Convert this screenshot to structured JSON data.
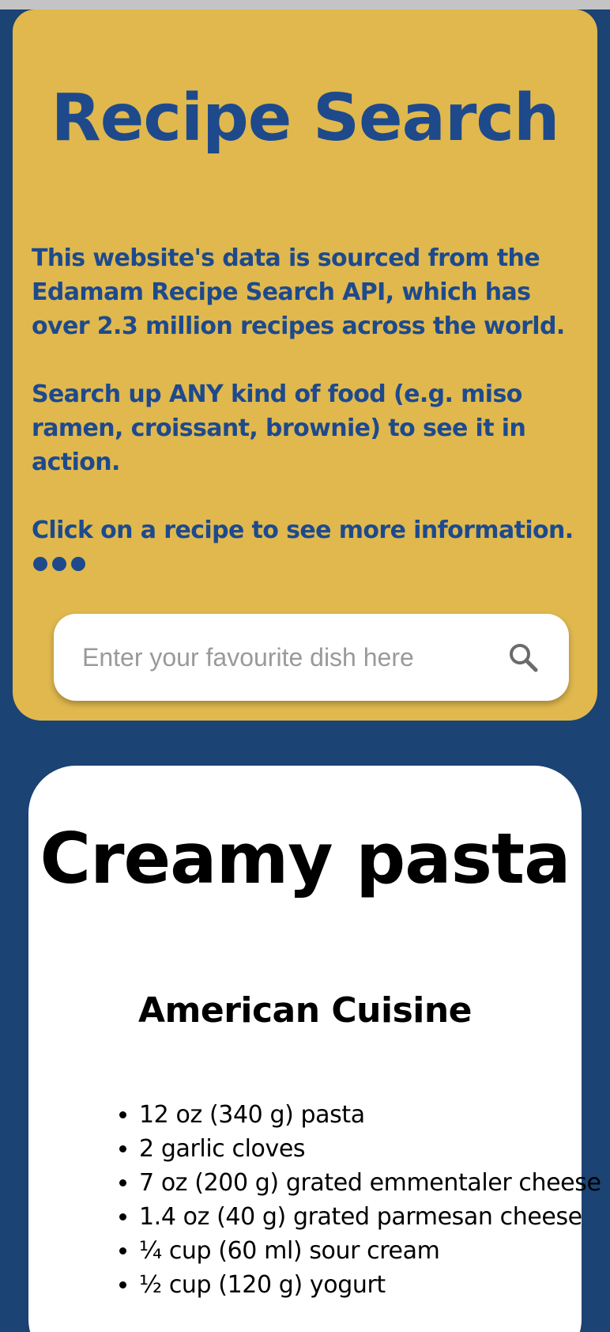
{
  "header": {
    "title": "Recipe Search",
    "description": [
      "This website's data is sourced from the Edamam Recipe Search API, which has over 2.3 million recipes across the world.",
      "Search up ANY kind of food (e.g. miso ramen, croissant, brownie) to see it in action.",
      "Click on a recipe to see more information."
    ]
  },
  "search": {
    "placeholder": "Enter your favourite dish here",
    "value": "",
    "icon": "search-icon"
  },
  "recipe": {
    "title": "Creamy pasta",
    "cuisine": "American Cuisine",
    "ingredients": [
      "12 oz (340 g) pasta",
      "2 garlic cloves",
      "7 oz (200 g) grated emmentaler cheese",
      "1.4 oz (40 g) grated parmesan cheese",
      "¼ cup (60 ml) sour cream",
      "½ cup (120 g) yogurt"
    ]
  },
  "colors": {
    "background": "#1b4373",
    "hero": "#e0b84e",
    "accent_text": "#1e4a8c"
  }
}
